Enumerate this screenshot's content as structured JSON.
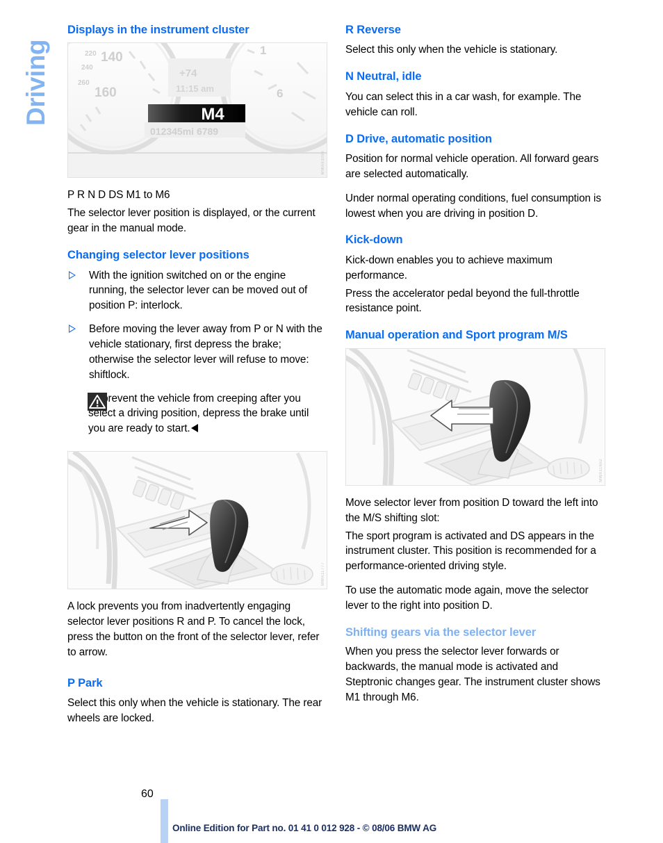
{
  "chapter": {
    "tab_label": "Driving"
  },
  "left_column": {
    "heading_displays": "Displays in the instrument cluster",
    "cluster_figure": {
      "alt_name": "instrument-cluster-illustration",
      "credit_code": "MWA93099",
      "gear_display": "M4",
      "temperature": "+74",
      "clock": "11:15 am",
      "odometer": "012345mi 6789",
      "speed_ticks": [
        "220",
        "240",
        "260",
        "140",
        "160"
      ]
    },
    "positions_line": "P R N D DS M1 to M6",
    "positions_body": "The selector lever position is displayed, or the current gear in the manual mode.",
    "heading_changing": "Changing selector lever positions",
    "bullets": [
      "With the ignition switched on or the engine running, the selector lever can be moved out of position P: interlock.",
      "Before moving the lever away from P or N with the vehicle stationary, first depress the brake; otherwise the selector lever will refuse to move: shiftlock."
    ],
    "warning": {
      "icon_name": "warning-triangle-icon",
      "text": "To prevent the vehicle from creeping after you select a driving position, depress the brake until you are ready to start."
    },
    "lever_figure": {
      "alt_name": "selector-lever-lock-button-illustration",
      "credit_code": "MWA11777"
    },
    "lock_body": "A lock prevents you from inadvertently engaging selector lever positions R and P. To cancel the lock, press the button on the front of the selector lever, refer to arrow.",
    "heading_park": "P Park",
    "park_body": "Select this only when the vehicle is stationary. The rear wheels are locked."
  },
  "right_column": {
    "heading_reverse": "R Reverse",
    "reverse_body": "Select this only when the vehicle is stationary.",
    "heading_neutral": "N Neutral, idle",
    "neutral_body": "You can select this in a car wash, for example. The vehicle can roll.",
    "heading_drive": "D Drive, automatic position",
    "drive_body_1": "Position for normal vehicle operation. All forward gears are selected automatically.",
    "drive_body_2": "Under normal operating conditions, fuel consumption is lowest when you are driving in position D.",
    "heading_kickdown": "Kick-down",
    "kickdown_body_1": "Kick-down enables you to achieve maximum performance.",
    "kickdown_body_2": "Press the accelerator pedal beyond the full-throttle resistance point.",
    "heading_manual": "Manual operation and Sport program M/S",
    "manual_figure": {
      "alt_name": "selector-lever-ms-slot-illustration",
      "credit_code": "MWA11692"
    },
    "manual_body_1": "Move selector lever from position D toward the left into the M/S shifting slot:",
    "manual_body_2": "The sport program is activated and DS appears in the instrument cluster. This position is recommended for a performance-oriented driving style.",
    "manual_body_3": "To use the automatic mode again, move the selector lever to the right into position D.",
    "heading_shifting": "Shifting gears via the selector lever",
    "shifting_body": "When you press the selector lever forwards or backwards, the manual mode is activated and Steptronic changes gear. The instrument cluster shows M1 through M6."
  },
  "footer": {
    "page_number": "60",
    "edition_text": "Online Edition for Part no. 01 41 0 012 928 - © 08/06 BMW AG"
  },
  "colors": {
    "heading_blue": "#0a6cf0",
    "subheading_blue": "#7fb0f0",
    "tab_blue": "#83b4f2",
    "footer_navy": "#1b2f63",
    "footer_bar": "#b6d2f5"
  }
}
